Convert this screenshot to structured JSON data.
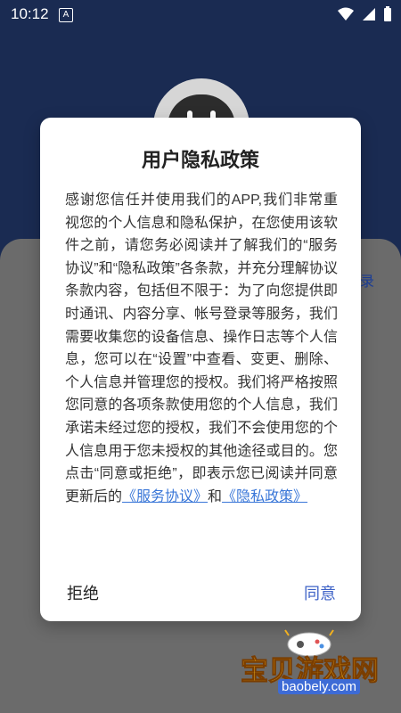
{
  "status_bar": {
    "time": "10:12",
    "notification_icon_letter": "A"
  },
  "background": {
    "side_text": "录"
  },
  "dialog": {
    "title": "用户隐私政策",
    "body_text": "感谢您信任并使用我们的APP,我们非常重视您的个人信息和隐私保护，在您使用该软件之前，请您务必阅读并了解我们的“服务协议”和“隐私政策”各条款，并充分理解协议条款内容，包括但不限于：为了向您提供即时通讯、内容分享、帐号登录等服务，我们需要收集您的设备信息、操作日志等个人信息，您可以在“设置”中查看、变更、删除、个人信息并管理您的授权。我们将严格按照您同意的各项条款使用您的个人信息，我们承诺未经过您的授权，我们不会使用您的个人信息用于您未授权的其他途径或目的。您点击“同意或拒绝”，即表示您已阅读并同意更新后的",
    "link_service": "《服务协议》",
    "conjunction": "和",
    "link_privacy": "《隐私政策》",
    "reject_label": "拒绝",
    "agree_label": "同意"
  },
  "watermark": {
    "title": "宝贝游戏网",
    "domain": "baobely.com"
  },
  "colors": {
    "background": "#1a2b52",
    "link": "#3a77d8",
    "agree": "#3f63c7"
  }
}
